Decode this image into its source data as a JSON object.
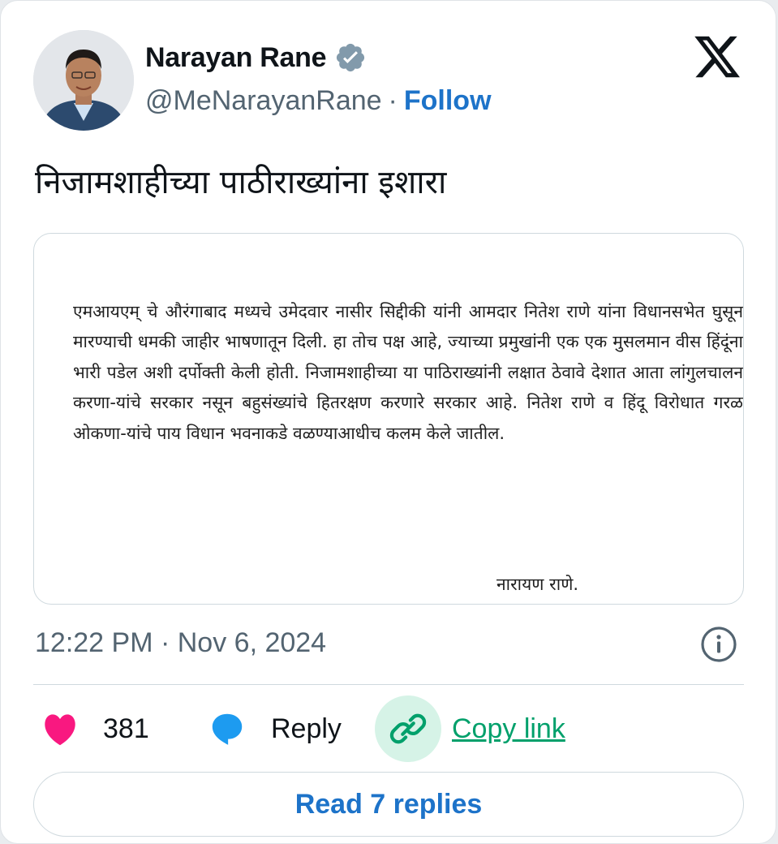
{
  "author": {
    "display_name": "Narayan Rane",
    "handle": "@MeNarayanRane",
    "separator": "·",
    "follow_label": "Follow",
    "verified": true
  },
  "tweet": {
    "text": "निजामशाहीच्या पाठीराख्यांना इशारा"
  },
  "media": {
    "letter_body": "एमआयएम् चे औरंगाबाद मध्यचे उमेदवार नासीर सिद्दीकी यांनी आमदार नितेश राणे यांना विधानसभेत घुसून मारण्याची धमकी जाहीर भाषणातून दिली. हा तोच पक्ष आहे, ज्याच्या प्रमुखांनी एक एक मुसलमान वीस हिंदूंना भारी पडेल अशी दर्पोक्ती केली होती. निजामशाहीच्या या पाठिराख्यांनी लक्षात ठेवावे देशात आता लांगुलचालन करणा-यांचे सरकार नसून बहुसंख्यांचे हितरक्षण करणारे सरकार आहे. नितेश राणे व हिंदू विरोधात गरळ ओकणा-यांचे पाय विधान भवनाकडे वळण्याआधीच कलम केले जातील.",
    "signature": "नारायण राणे."
  },
  "meta": {
    "timestamp": "12:22 PM · Nov 6, 2024"
  },
  "actions": {
    "like_count": "381",
    "reply_label": "Reply",
    "copy_link_label": "Copy link"
  },
  "footer": {
    "read_replies_label": "Read 7 replies"
  },
  "colors": {
    "accent_blue": "#1d73c9",
    "like_pink": "#f91880",
    "reply_blue": "#1d9bf0",
    "link_green": "#00a06b",
    "text_primary": "#0f1419",
    "text_secondary": "#536471"
  },
  "icons": {
    "verified": "verified-badge-icon",
    "brand": "x-logo-icon",
    "info": "info-icon",
    "like": "heart-icon",
    "reply": "reply-bubble-icon",
    "copy": "link-icon"
  }
}
